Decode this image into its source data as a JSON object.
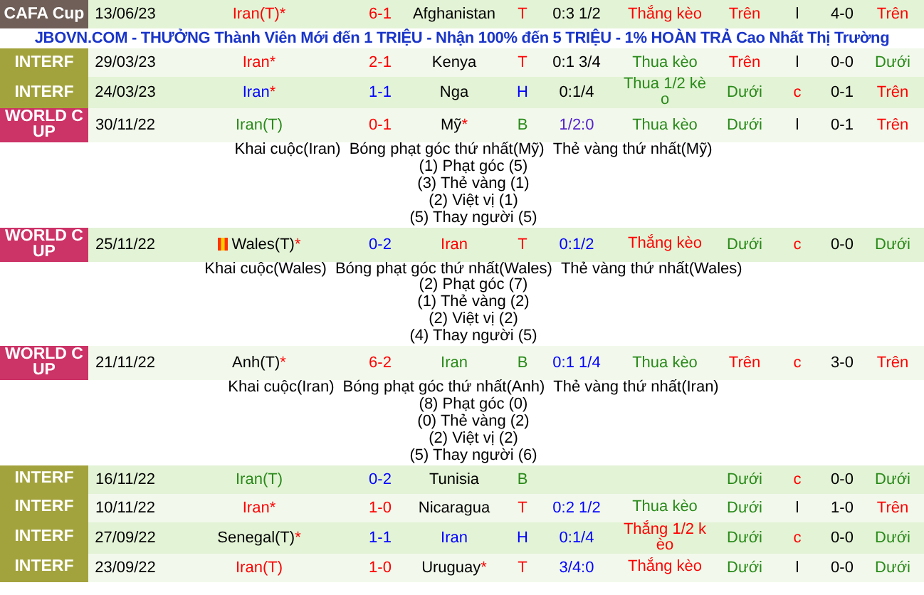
{
  "matches": [
    {
      "league": {
        "label": "CAFA Cup",
        "kind": "cafa"
      },
      "date": "13/06/23",
      "home": {
        "text": "Iran(T)",
        "star": "*",
        "flag": false,
        "color": "#ff0000"
      },
      "score": {
        "text": "6-1",
        "color": "#ff0000"
      },
      "away": {
        "text": "Afghanistan",
        "flag": false,
        "color": "#000000"
      },
      "result": {
        "text": "T",
        "color": "#ff0000"
      },
      "handicap": {
        "text": "0:3 1/2",
        "color": "#000000"
      },
      "handicap_result": {
        "text": "Thắng kèo",
        "color": "#ff0000"
      },
      "over_under": {
        "text": "Trên",
        "color": "#ff0000"
      },
      "half": {
        "text": "l",
        "color": "#000000"
      },
      "ht_score": "4-0",
      "last": {
        "text": "Trên",
        "color": "#ff0000"
      }
    },
    {
      "kind": "banner",
      "text": "JBOVN.COM - THƯỞNG Thành Viên Mới đến 1 TRIỆU - Nhận 100% đến 5 TRIỆU - 1% HOÀN TRẢ Cao Nhất Thị Trường"
    },
    {
      "league": {
        "label": "INTERF",
        "kind": "interf"
      },
      "date": "29/03/23",
      "home": {
        "text": "Iran",
        "star": "*",
        "flag": false,
        "color": "#ff0000"
      },
      "score": {
        "text": "2-1",
        "color": "#ff0000"
      },
      "away": {
        "text": "Kenya",
        "flag": false,
        "color": "#000000"
      },
      "result": {
        "text": "T",
        "color": "#ff0000"
      },
      "handicap": {
        "text": "0:1 3/4",
        "color": "#000000"
      },
      "handicap_result": {
        "text": "Thua kèo",
        "color": "#2a8a1a"
      },
      "over_under": {
        "text": "Trên",
        "color": "#ff0000"
      },
      "half": {
        "text": "l",
        "color": "#000000"
      },
      "ht_score": "0-0",
      "last": {
        "text": "Dưới",
        "color": "#2a8a1a"
      }
    },
    {
      "league": {
        "label": "INTERF",
        "kind": "interf"
      },
      "date": "24/03/23",
      "home": {
        "text": "Iran",
        "star": "*",
        "flag": false,
        "color": "#0000ff"
      },
      "score": {
        "text": "1-1",
        "color": "#0000ff"
      },
      "away": {
        "text": "Nga",
        "flag": false,
        "color": "#000000"
      },
      "result": {
        "text": "H",
        "color": "#0000ff"
      },
      "handicap": {
        "text": "0:1/4",
        "color": "#000000"
      },
      "handicap_result": {
        "text": "Thua 1/2 kèo",
        "color": "#2a8a1a"
      },
      "over_under": {
        "text": "Dưới",
        "color": "#2a8a1a"
      },
      "half": {
        "text": "c",
        "color": "#ff0000"
      },
      "ht_score": "0-1",
      "last": {
        "text": "Trên",
        "color": "#ff0000"
      }
    },
    {
      "league": {
        "label": "WORLD CUP",
        "kind": "worldcup"
      },
      "date": "30/11/22",
      "home": {
        "text": "Iran(T)",
        "flag": false,
        "color": "#2a8a1a"
      },
      "score": {
        "text": "0-1",
        "color": "#ff0000"
      },
      "away": {
        "text": "Mỹ",
        "star": "*",
        "flag": false,
        "color": "#000000"
      },
      "result": {
        "text": "B",
        "color": "#2a8a1a"
      },
      "handicap": {
        "text": "1/2:0",
        "color": "#5522cc"
      },
      "handicap_result": {
        "text": "Thua kèo",
        "color": "#2a8a1a"
      },
      "over_under": {
        "text": "Dưới",
        "color": "#2a8a1a"
      },
      "half": {
        "text": "l",
        "color": "#000000"
      },
      "ht_score": "0-1",
      "last": {
        "text": "Trên",
        "color": "#ff0000"
      },
      "details": [
        [
          "Khai cuộc(Iran)",
          "Bóng phạt góc thứ nhất(Mỹ)",
          "Thẻ vàng thứ nhất(Mỹ)"
        ],
        [
          "(1) Phạt góc (5)"
        ],
        [
          "(3) Thẻ vàng (1)"
        ],
        [
          "(2) Việt vị (1)"
        ],
        [
          "(5) Thay người (5)"
        ]
      ]
    },
    {
      "league": {
        "label": "WORLD CUP",
        "kind": "worldcup"
      },
      "date": "25/11/22",
      "home": {
        "text": "Wales(T)",
        "star": "*",
        "flag": true,
        "color": "#000000"
      },
      "score": {
        "text": "0-2",
        "color": "#0000ff"
      },
      "away": {
        "text": "Iran",
        "flag": false,
        "color": "#ff0000"
      },
      "result": {
        "text": "T",
        "color": "#ff0000"
      },
      "handicap": {
        "text": "0:1/2",
        "color": "#0000ff"
      },
      "handicap_result": {
        "text": "Thắng kèo",
        "color": "#ff0000"
      },
      "over_under": {
        "text": "Dưới",
        "color": "#2a8a1a"
      },
      "half": {
        "text": "c",
        "color": "#ff0000"
      },
      "ht_score": "0-0",
      "last": {
        "text": "Dưới",
        "color": "#2a8a1a"
      },
      "details": [
        [
          "Khai cuộc(Wales)",
          "Bóng phạt góc thứ nhất(Wales)",
          "Thẻ vàng thứ nhất(Wales)"
        ],
        [
          "(2) Phạt góc (7)"
        ],
        [
          "(1) Thẻ vàng (2)"
        ],
        [
          "(2) Việt vị (2)"
        ],
        [
          "(4) Thay người (5)"
        ]
      ]
    },
    {
      "league": {
        "label": "WORLD CUP",
        "kind": "worldcup"
      },
      "date": "21/11/22",
      "home": {
        "text": "Anh(T)",
        "star": "*",
        "flag": false,
        "color": "#000000"
      },
      "score": {
        "text": "6-2",
        "color": "#ff0000"
      },
      "away": {
        "text": "Iran",
        "flag": false,
        "color": "#2a8a1a"
      },
      "result": {
        "text": "B",
        "color": "#2a8a1a"
      },
      "handicap": {
        "text": "0:1 1/4",
        "color": "#0000ff"
      },
      "handicap_result": {
        "text": "Thua kèo",
        "color": "#2a8a1a"
      },
      "over_under": {
        "text": "Trên",
        "color": "#ff0000"
      },
      "half": {
        "text": "c",
        "color": "#ff0000"
      },
      "ht_score": "3-0",
      "last": {
        "text": "Trên",
        "color": "#ff0000"
      },
      "details": [
        [
          "Khai cuộc(Iran)",
          "Bóng phạt góc thứ nhất(Anh)",
          "Thẻ vàng thứ nhất(Iran)"
        ],
        [
          "(8) Phạt góc (0)"
        ],
        [
          "(0) Thẻ vàng (2)"
        ],
        [
          "(2) Việt vị (2)"
        ],
        [
          "(5) Thay người (6)"
        ]
      ]
    },
    {
      "league": {
        "label": "INTERF",
        "kind": "interf"
      },
      "date": "16/11/22",
      "home": {
        "text": "Iran(T)",
        "flag": false,
        "color": "#2a8a1a"
      },
      "score": {
        "text": "0-2",
        "color": "#0000ff"
      },
      "away": {
        "text": "Tunisia",
        "flag": false,
        "color": "#000000"
      },
      "result": {
        "text": "B",
        "color": "#2a8a1a"
      },
      "over_under": {
        "text": "Dưới",
        "color": "#2a8a1a"
      },
      "half": {
        "text": "c",
        "color": "#ff0000"
      },
      "ht_score": "0-0",
      "last": {
        "text": "Dưới",
        "color": "#2a8a1a"
      }
    },
    {
      "league": {
        "label": "INTERF",
        "kind": "interf"
      },
      "date": "10/11/22",
      "home": {
        "text": "Iran",
        "star": "*",
        "flag": false,
        "color": "#ff0000"
      },
      "score": {
        "text": "1-0",
        "color": "#ff0000"
      },
      "away": {
        "text": "Nicaragua",
        "flag": false,
        "color": "#000000"
      },
      "result": {
        "text": "T",
        "color": "#ff0000"
      },
      "handicap": {
        "text": "0:2 1/2",
        "color": "#0000ff"
      },
      "handicap_result": {
        "text": "Thua kèo",
        "color": "#2a8a1a"
      },
      "over_under": {
        "text": "Dưới",
        "color": "#2a8a1a"
      },
      "half": {
        "text": "l",
        "color": "#000000"
      },
      "ht_score": "1-0",
      "last": {
        "text": "Trên",
        "color": "#ff0000"
      }
    },
    {
      "league": {
        "label": "INTERF",
        "kind": "interf"
      },
      "date": "27/09/22",
      "home": {
        "text": "Senegal(T)",
        "star": "*",
        "flag": false,
        "color": "#000000"
      },
      "score": {
        "text": "1-1",
        "color": "#0000ff"
      },
      "away": {
        "text": "Iran",
        "flag": false,
        "color": "#0000ff"
      },
      "result": {
        "text": "H",
        "color": "#0000ff"
      },
      "handicap": {
        "text": "0:1/4",
        "color": "#0000ff"
      },
      "handicap_result": {
        "text": "Thắng 1/2 kèo",
        "color": "#ff0000"
      },
      "over_under": {
        "text": "Dưới",
        "color": "#2a8a1a"
      },
      "half": {
        "text": "c",
        "color": "#ff0000"
      },
      "ht_score": "0-0",
      "last": {
        "text": "Dưới",
        "color": "#2a8a1a"
      }
    },
    {
      "league": {
        "label": "INTERF",
        "kind": "interf"
      },
      "date": "23/09/22",
      "home": {
        "text": "Iran(T)",
        "flag": false,
        "color": "#ff0000"
      },
      "score": {
        "text": "1-0",
        "color": "#ff0000"
      },
      "away": {
        "text": "Uruguay",
        "star": "*",
        "flag": false,
        "color": "#000000"
      },
      "result": {
        "text": "T",
        "color": "#ff0000"
      },
      "handicap": {
        "text": "3/4:0",
        "color": "#0000ff"
      },
      "handicap_result": {
        "text": "Thắng kèo",
        "color": "#ff0000"
      },
      "over_under": {
        "text": "Dưới",
        "color": "#2a8a1a"
      },
      "half": {
        "text": "l",
        "color": "#000000"
      },
      "ht_score": "0-0",
      "last": {
        "text": "Dưới",
        "color": "#2a8a1a"
      }
    }
  ]
}
